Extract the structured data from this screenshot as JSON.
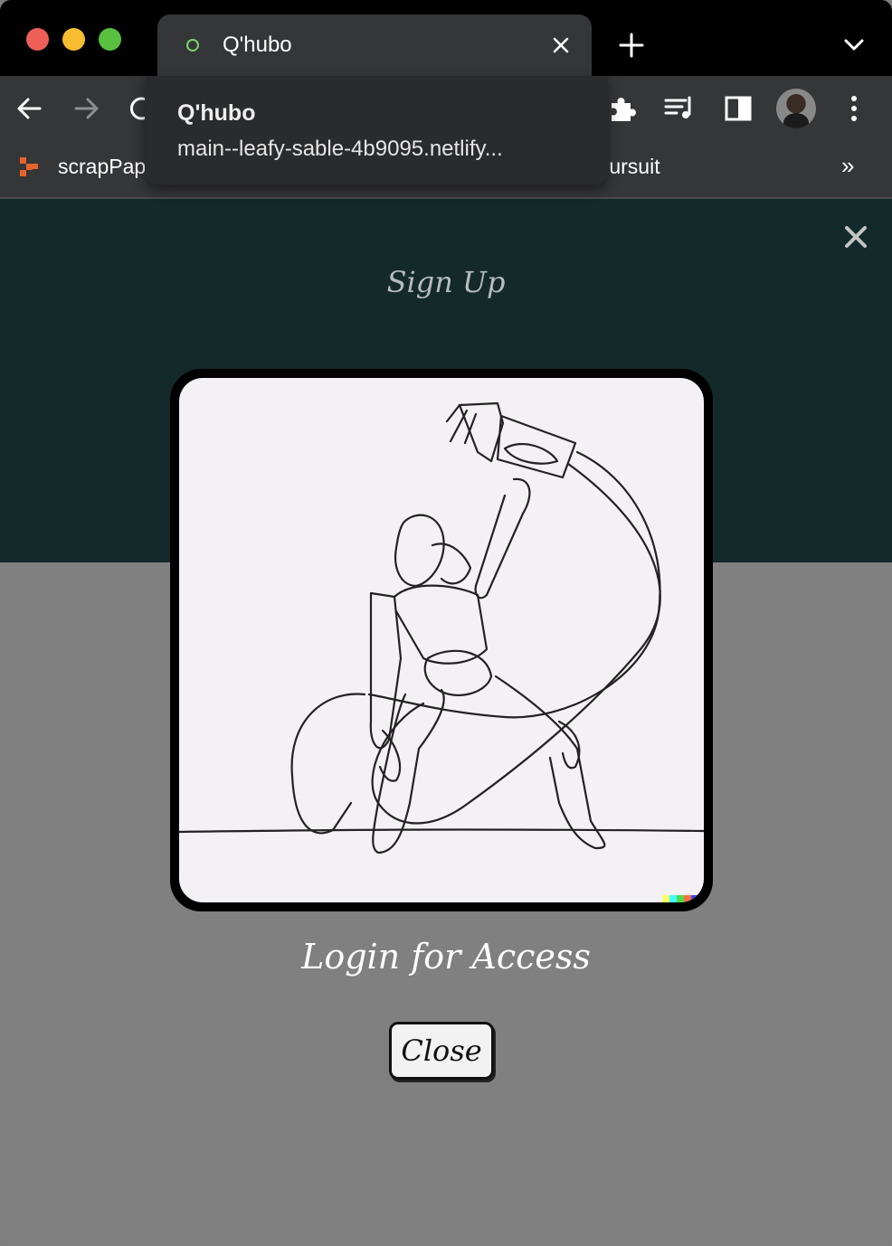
{
  "browser": {
    "tab": {
      "title": "Q'hubo",
      "favicon": "chat-bubble-icon",
      "favicon_color": "#7bd36f"
    },
    "hover_card": {
      "title": "Q'hubo",
      "url": "main--leafy-sable-4b9095.netlify..."
    },
    "bookmarks": {
      "items": [
        {
          "label": "scrapPap",
          "icon": "scrappaper-logo-icon"
        },
        {
          "label": "Pursuit"
        }
      ],
      "more": "»"
    },
    "toolbar_icons": [
      "back-arrow-icon",
      "forward-arrow-icon",
      "reload-icon",
      "extensions-puzzle-icon",
      "media-control-icon",
      "side-panel-icon",
      "profile-avatar",
      "kebab-menu-icon"
    ]
  },
  "page": {
    "header_bg": "#13292a",
    "signup_label": "Sign Up",
    "modal": {
      "image": "line-drawing-dancer",
      "message": "Login for Access",
      "close_label": "Close"
    }
  }
}
